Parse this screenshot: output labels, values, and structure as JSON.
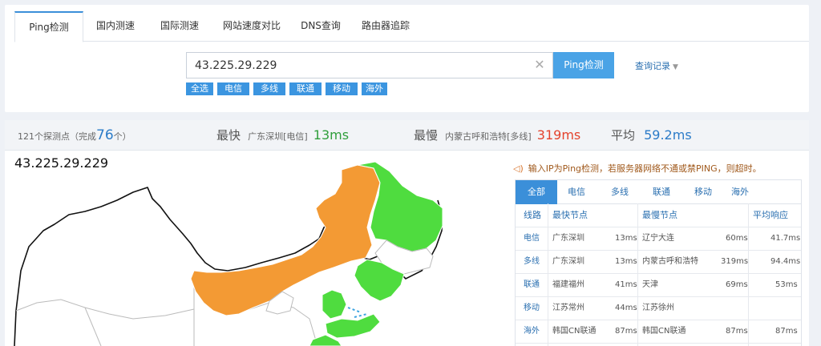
{
  "tabs": [
    "Ping检测",
    "国内测速",
    "国际测速",
    "网站速度对比",
    "DNS查询",
    "路由器追踪"
  ],
  "search": {
    "value": "43.225.29.229",
    "button_label": "Ping检测",
    "clear_icon": "close-icon"
  },
  "history_label": "查询记录",
  "filters": [
    "全选",
    "电信",
    "多线",
    "联通",
    "移动",
    "海外"
  ],
  "stats": {
    "total_prefix": "121个探测点（完成",
    "done": "76",
    "total_suffix": "个）",
    "fastest_label": "最快",
    "fastest_node": "广东深圳[电信]",
    "fastest_value": "13ms",
    "slowest_label": "最慢",
    "slowest_node": "内蒙古呼和浩特[多线]",
    "slowest_value": "319ms",
    "avg_label": "平均",
    "avg_value": "59.2ms"
  },
  "map_title": "43.225.29.229",
  "notice": "输入IP为Ping检测，若服务器网络不通或禁PING，则超时。",
  "panel_tabs": [
    "全部",
    "电信",
    "多线",
    "联通",
    "移动",
    "海外"
  ],
  "table": {
    "headers": [
      "线路",
      "最快节点",
      "最慢节点",
      "平均响应"
    ],
    "rows": [
      {
        "line": "电信",
        "fast_node": "广东深圳",
        "fast_ms": "13ms",
        "slow_node": "辽宁大连",
        "slow_ms": "60ms",
        "avg": "41.7ms"
      },
      {
        "line": "多线",
        "fast_node": "广东深圳",
        "fast_ms": "13ms",
        "slow_node": "内蒙古呼和浩特",
        "slow_ms": "319ms",
        "avg": "94.4ms"
      },
      {
        "line": "联通",
        "fast_node": "福建福州",
        "fast_ms": "41ms",
        "slow_node": "天津",
        "slow_ms": "69ms",
        "avg": "53ms"
      },
      {
        "line": "移动",
        "fast_node": "江苏常州",
        "fast_ms": "44ms",
        "slow_node": "江苏徐州",
        "slow_ms": "",
        "avg": ""
      },
      {
        "line": "海外",
        "fast_node": "韩国CN联通",
        "fast_ms": "87ms",
        "slow_node": "韩国CN联通",
        "slow_ms": "87ms",
        "avg": "87ms"
      }
    ]
  },
  "colors": {
    "accent": "#3b8fd9",
    "slow_region": "#f39a34",
    "fast_region": "#4fdc3f",
    "fast_text": "#2f9e3b",
    "slow_text": "#e4432d"
  }
}
